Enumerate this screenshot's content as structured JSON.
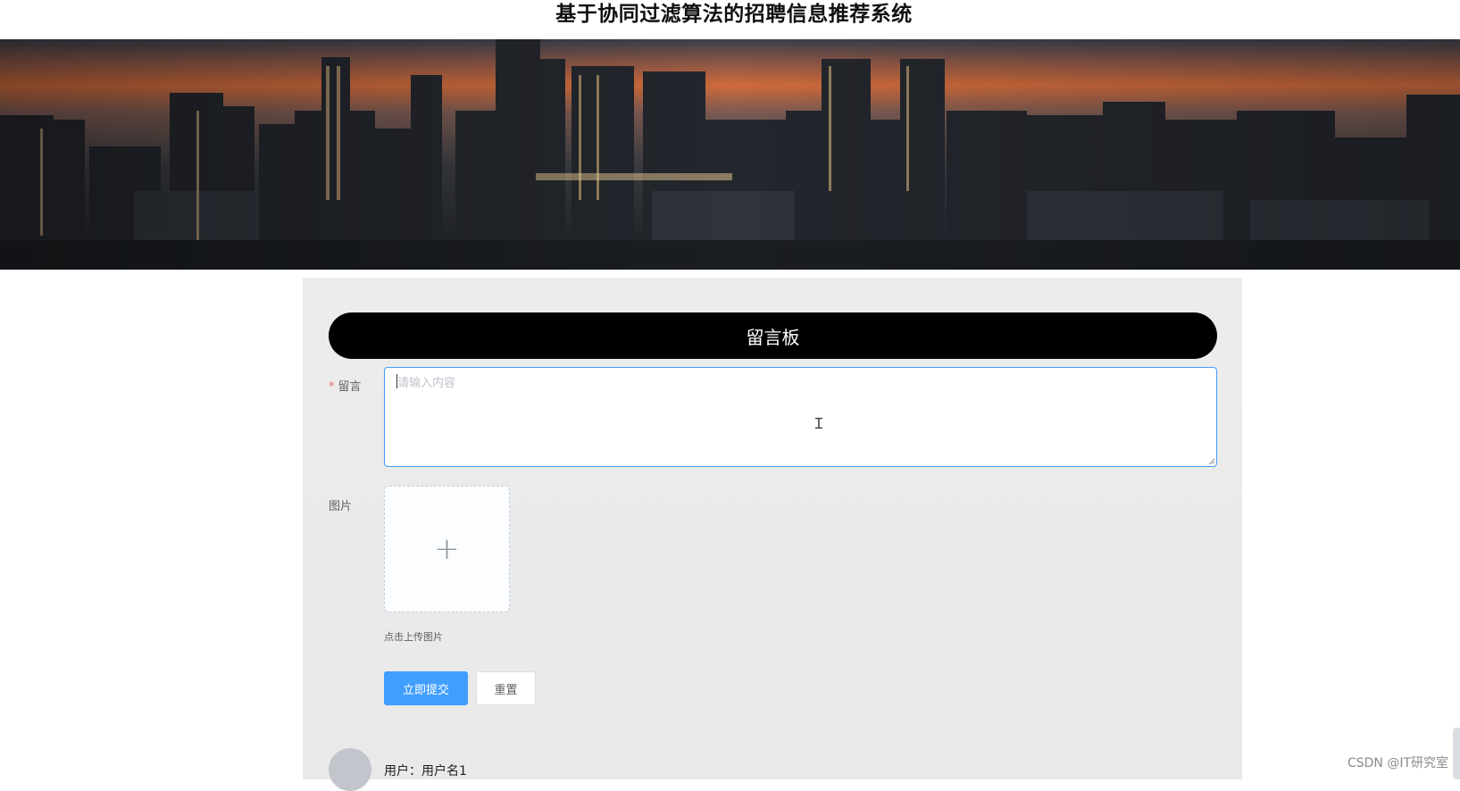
{
  "header": {
    "title": "基于协同过滤算法的招聘信息推荐系统"
  },
  "banner": {
    "slides_total": 3,
    "active_slide": 1
  },
  "board": {
    "title": "留言板"
  },
  "form": {
    "message_label": "留言",
    "message_required_mark": "*",
    "message_placeholder": "请输入内容",
    "message_value": "",
    "image_label": "图片",
    "upload_icon": "+",
    "upload_tip": "点击上传图片",
    "submit_label": "立即提交",
    "reset_label": "重置"
  },
  "comments": [
    {
      "user_text": "用户：用户名1"
    }
  ],
  "watermark": "CSDN @IT研究室",
  "colors": {
    "primary": "#409eff",
    "required": "#f56c6c",
    "board_bar": "#000000"
  }
}
